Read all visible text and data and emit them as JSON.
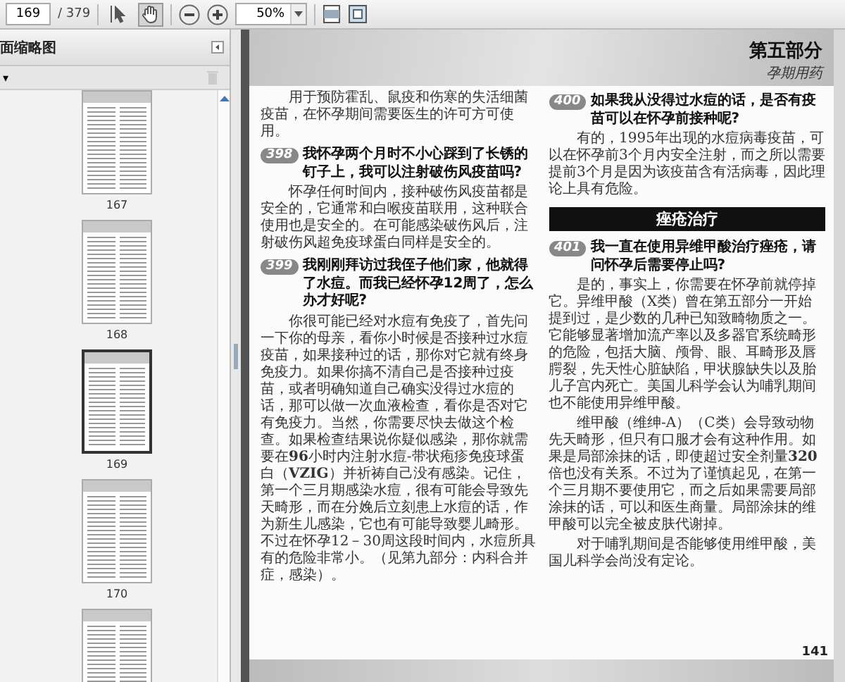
{
  "toolbar": {
    "page_number": "169",
    "page_count": "/ 379",
    "tools": [
      {
        "kind": "select",
        "selected": false
      },
      {
        "kind": "hand",
        "selected": true
      }
    ],
    "zoom": "50%"
  },
  "sidebar": {
    "title": "面缩略图",
    "options": "▾",
    "thumbnails": [
      {
        "label": "167",
        "selected": false
      },
      {
        "label": "168",
        "selected": false
      },
      {
        "label": "169",
        "selected": true
      },
      {
        "label": "170",
        "selected": false
      },
      {
        "selected": false
      }
    ]
  },
  "page": {
    "part": "第五部分",
    "subtitle": "孕期用药",
    "page_number": "141",
    "columns": [
      [
        {
          "kind": "paragraph",
          "text": "用于预防霍乱、鼠疫和伤寒的失活细菌疫苗，在怀孕期间需要医生的许可方可使用。"
        },
        {
          "kind": "question",
          "number": "398",
          "text": "我怀孕两个月时不小心踩到了长锈的钉子上，我可以注射破伤风疫苗吗?"
        },
        {
          "kind": "paragraph",
          "text": "怀孕任何时间内，接种破伤风疫苗都是安全的，它通常和白喉疫苗联用，这种联合使用也是安全的。在可能感染破伤风后，注射破伤风超免疫球蛋白同样是安全的。"
        },
        {
          "kind": "question",
          "number": "399",
          "text": "我刚刚拜访过我侄子他们家，他就得了水痘。而我已经怀孕12周了，怎么办才好呢?"
        },
        {
          "kind": "paragraph",
          "text": "你很可能已经对水痘有免疫了，首先问一下你的母亲，看你小时候是否接种过水痘疫苗，如果接种过的话，那你对它就有终身免疫力。如果你搞不清自己是否接种过疫苗，或者明确知道自己确实没得过水痘的话，那可以做一次血液检查，看你是否对它有免疫力。当然，你需要尽快去做这个检查。如果检查结果说你疑似感染，那你就需要在**96**小时内注射水痘-带状疱疹免疫球蛋白（**VZIG**）并祈祷自己没有感染。记住，第一个三月期感染水痘，很有可能会导致先天畸形，而在分娩后立刻患上水痘的话，作为新生儿感染，它也有可能导致婴儿畸形。不过在怀孕12－30周这段时间内，水痘所具有的危险非常小。（见第九部分：内科合并症，感染）。"
        }
      ],
      [
        {
          "kind": "question",
          "number": "400",
          "text": "如果我从没得过水痘的话，是否有疫苗可以在怀孕前接种呢?"
        },
        {
          "kind": "paragraph",
          "text": "有的，1995年出现的水痘病毒疫苗，可以在怀孕前3个月内安全注射，而之所以需要提前3个月是因为该疫苗含有活病毒，因此理论上具有危险。"
        },
        {
          "kind": "section",
          "text": "痤疮治疗"
        },
        {
          "kind": "question",
          "number": "401",
          "text": "我一直在使用异维甲酸治疗痤疮，请问怀孕后需要停止吗?"
        },
        {
          "kind": "paragraph",
          "text": "是的，事实上，你需要在怀孕前就停掉它。异维甲酸（X类）曾在第五部分一开始提到过，是少数的几种已知致畸物质之一。它能够显著增加流产率以及多器官系统畸形的危险，包括大脑、颅骨、眼、耳畸形及唇腭裂，先天性心脏缺陷，甲状腺缺失以及胎儿子宫内死亡。美国儿科学会认为哺乳期间也不能使用异维甲酸。"
        },
        {
          "kind": "paragraph",
          "text": "维甲酸（维绅-A）（C类）会导致动物先天畸形，但只有口服才会有这种作用。如果是局部涂抹的话，即使超过安全剂量**320**倍也没有关系。不过为了谨慎起见，在第一个三月期不要使用它，而之后如果需要局部涂抹的话，可以和医生商量。局部涂抹的维甲酸可以完全被皮肤代谢掉。"
        },
        {
          "kind": "paragraph",
          "text": "对于哺乳期间是否能够使用维甲酸，美国儿科学会尚没有定论。"
        }
      ]
    ]
  }
}
